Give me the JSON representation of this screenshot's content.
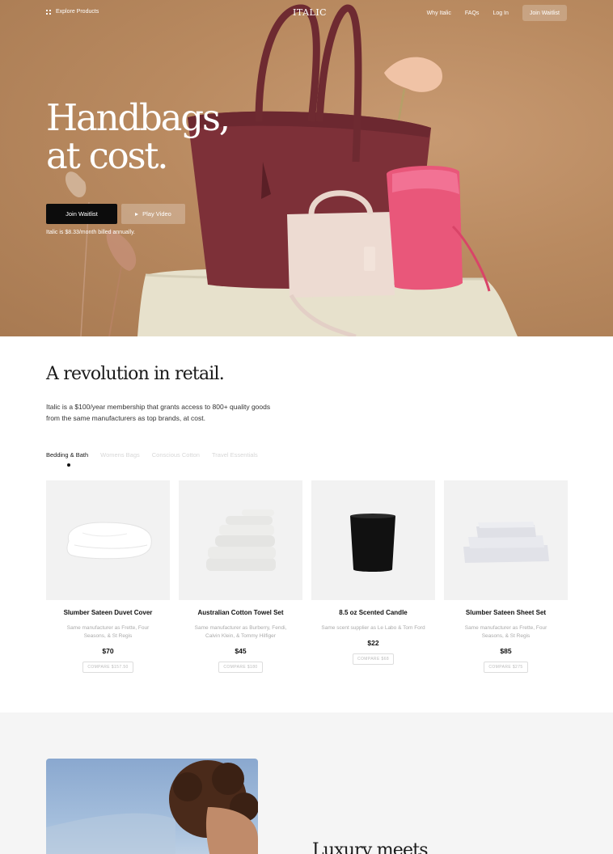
{
  "nav": {
    "explore_label": "Explore Products",
    "logo": "ITALIC",
    "links": [
      "Why Italic",
      "FAQs",
      "Log In"
    ],
    "cta": "Join Waitlist"
  },
  "hero": {
    "title_line1": "Handbags,",
    "title_line2": "at cost.",
    "primary_button": "Join Waitlist",
    "secondary_button": "Play Video",
    "note": "Italic is $8.33/month billed annually."
  },
  "revolution": {
    "title": "A revolution in retail.",
    "description": "Italic is a $100/year membership that grants access to 800+ quality goods from the same manufacturers as top brands, at cost."
  },
  "tabs": [
    "Bedding & Bath",
    "Womens Bags",
    "Conscious Cotton",
    "Travel Essentials"
  ],
  "active_tab": "Bedding & Bath",
  "products": [
    {
      "name": "Slumber Sateen Duvet Cover",
      "sub": "Same manufacturer as Frette, Four Seasons, & St Regis",
      "price": "$70",
      "compare": "COMPARE $157.50"
    },
    {
      "name": "Australian Cotton Towel Set",
      "sub": "Same manufacturer as Burberry, Fendi, Calvin Klein, & Tommy Hilfiger",
      "price": "$45",
      "compare": "COMPARE $180"
    },
    {
      "name": "8.5 oz Scented Candle",
      "sub": "Same scent supplier as Le Labo & Tom Ford",
      "price": "$22",
      "compare": "COMPARE $68"
    },
    {
      "name": "Slumber Sateen Sheet Set",
      "sub": "Same manufacturer as Frette, Four Seasons, & St Regis",
      "price": "$85",
      "compare": "COMPARE $275"
    }
  ],
  "lower": {
    "title": "Luxury meets"
  },
  "colors": {
    "hero_bg": "#b98a60",
    "dark_button": "#0c0c0c",
    "section_gray": "#f5f5f5"
  }
}
